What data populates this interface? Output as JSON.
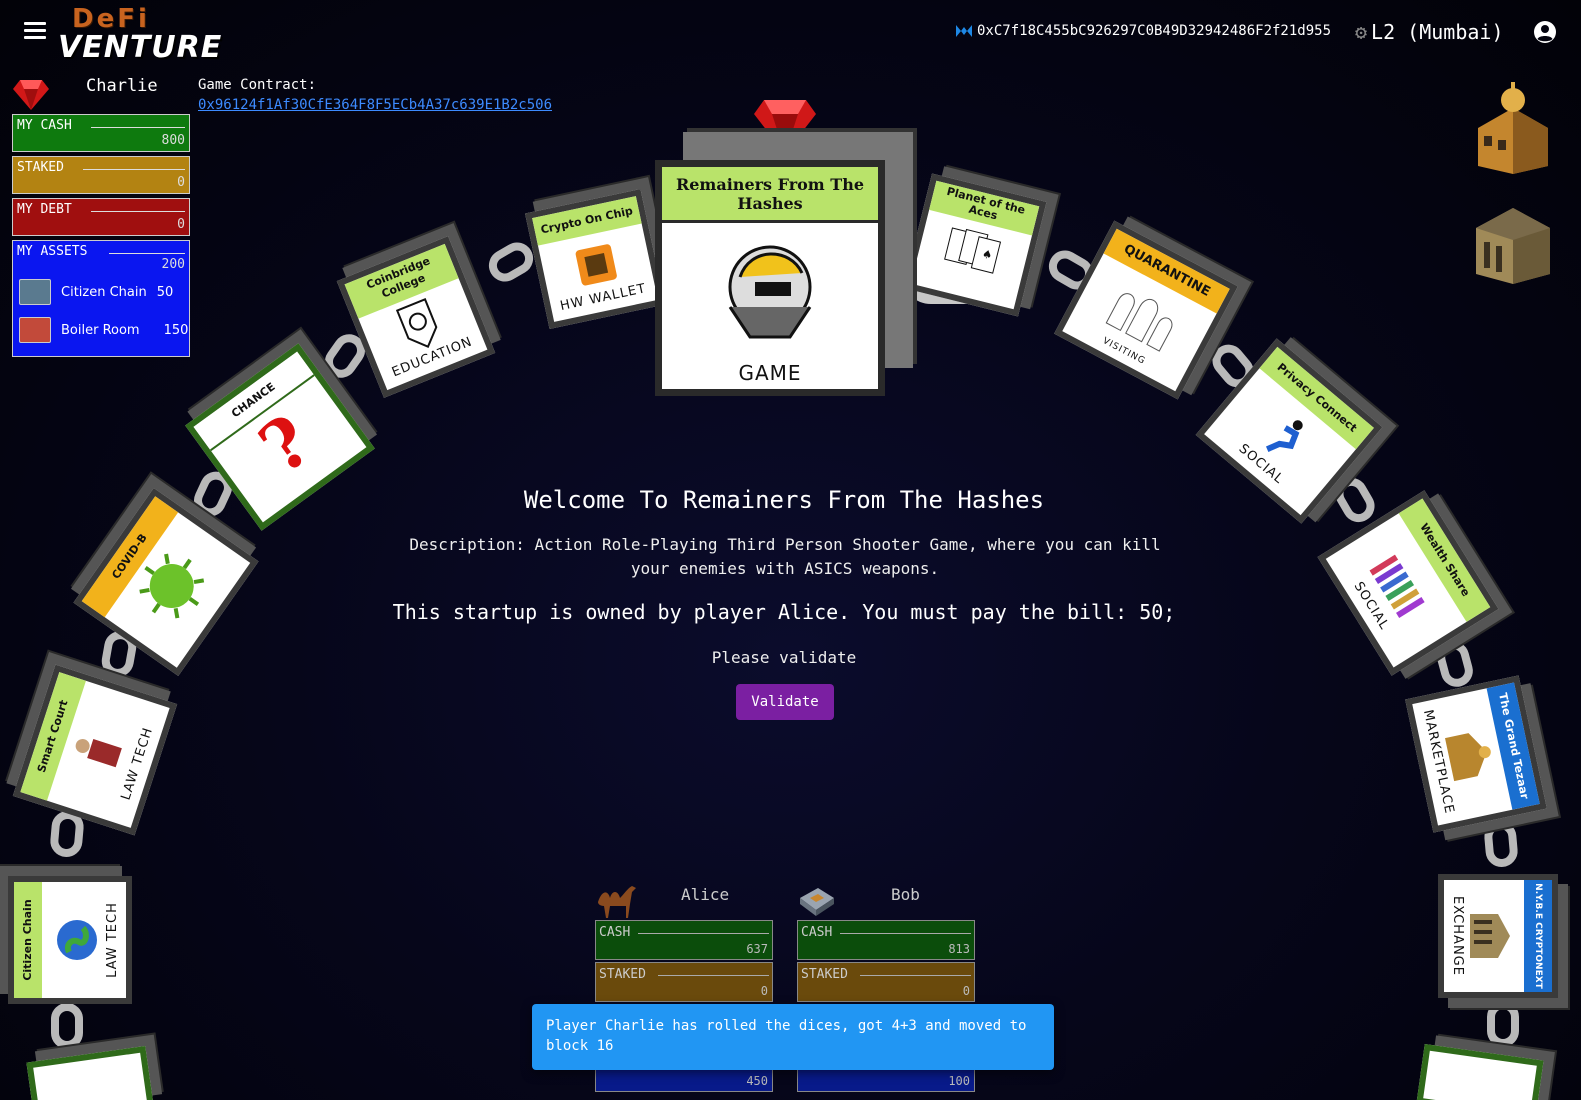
{
  "header": {
    "menu_icon": "hamburger-menu-icon",
    "logo_top": "DeFi",
    "logo_bottom": "VENTURE",
    "wallet_address": "0xC7f18C455bC926297C0B49D32942486F2f21d955",
    "network": "L2 (Mumbai)",
    "account_icon": "account-circle-icon"
  },
  "player": {
    "name": "Charlie",
    "game_contract_label": "Game Contract:",
    "game_contract_address": "0x96124f1Af30CfE364F8F5ECb4A37c639E1B2c506",
    "cash_label": "MY CASH",
    "cash_value": "800",
    "staked_label": "STAKED",
    "staked_value": "0",
    "debt_label": "MY DEBT",
    "debt_value": "0",
    "assets_label": "MY ASSETS",
    "assets_value": "200",
    "assets": [
      {
        "name": "Citizen Chain",
        "value": "50"
      },
      {
        "name": "Boiler Room",
        "value": "150"
      }
    ]
  },
  "board": {
    "center_title": "Remainers From The Hashes",
    "center_category": "GAME",
    "cards": [
      {
        "title": "Crypto On Chip",
        "category": "HW WALLET"
      },
      {
        "title": "Coinbridge College",
        "category": "EDUCATION"
      },
      {
        "title": "CHANCE",
        "category": ""
      },
      {
        "title": "COVID-B",
        "category": ""
      },
      {
        "title": "Smart Court",
        "category": "LAW TECH"
      },
      {
        "title": "Citizen Chain",
        "category": "LAW TECH"
      },
      {
        "title": "Planet of the Aces",
        "category": ""
      },
      {
        "title": "QUARANTINE",
        "category": "VISITING"
      },
      {
        "title": "Privacy Connect",
        "category": "SOCIAL"
      },
      {
        "title": "Wealth Share",
        "category": "SOCIAL"
      },
      {
        "title": "The Grand Tezaar",
        "category": "MARKETPLACE"
      },
      {
        "title": "N.Y.B.E CRYPTONEXT",
        "category": "EXCHANGE"
      }
    ]
  },
  "dialog": {
    "welcome": "Welcome To Remainers From The Hashes",
    "description": "Description: Action Role-Playing Third Person Shooter Game, where you can kill your enemies with ASICS weapons.",
    "bill": "This startup is owned by player Alice. You must pay the bill: 50;",
    "please": "Please validate",
    "validate_label": "Validate"
  },
  "opponents": [
    {
      "name": "Alice",
      "cash_label": "CASH",
      "cash": "637",
      "staked_label": "STAKED",
      "staked": "0",
      "assets": "450",
      "icon": "camel-icon"
    },
    {
      "name": "Bob",
      "cash_label": "CASH",
      "cash": "813",
      "staked_label": "STAKED",
      "staked": "0",
      "assets": "100",
      "icon": "chip-icon"
    }
  ],
  "toast": {
    "message": "Player Charlie has rolled the dices, got 4+3 and moved to block 16"
  },
  "colors": {
    "cash": "#0e7a0e",
    "staked": "#b38312",
    "debt": "#a00f0f",
    "assets": "#0a16f0",
    "validate": "#7b1fa2",
    "toast": "#2196f3",
    "card_band": "#b9e36a"
  }
}
